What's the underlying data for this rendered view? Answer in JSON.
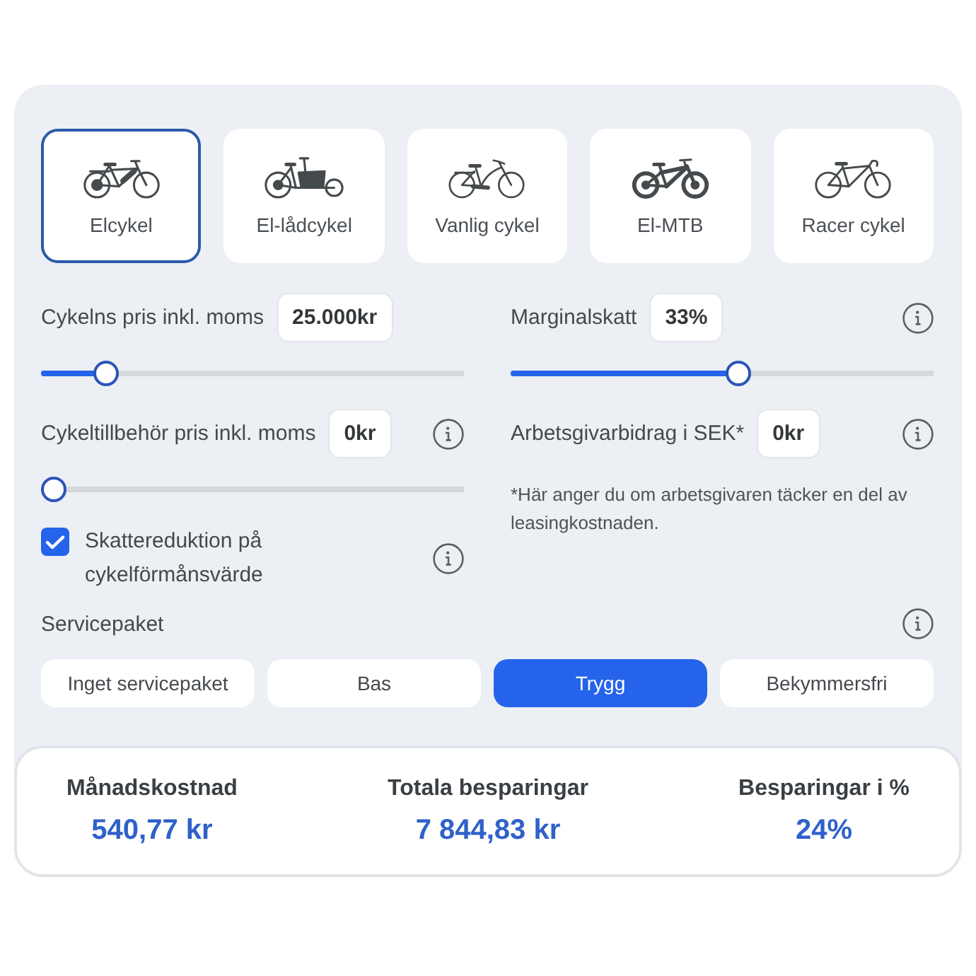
{
  "bike_types": [
    {
      "label": "Elcykel",
      "kind": "ebike",
      "selected": true
    },
    {
      "label": "El-lådcykel",
      "kind": "cargo",
      "selected": false
    },
    {
      "label": "Vanlig cykel",
      "kind": "city",
      "selected": false
    },
    {
      "label": "El-MTB",
      "kind": "mtb",
      "selected": false
    },
    {
      "label": "Racer cykel",
      "kind": "road",
      "selected": false
    }
  ],
  "controls": {
    "left": [
      {
        "kind": "slider",
        "label": "Cykelns pris inkl. moms",
        "value": "25.000kr",
        "level": 0.13
      },
      {
        "kind": "slider",
        "label": "Cykeltillbehör pris inkl. moms",
        "value": "0kr",
        "level": 0,
        "info": true
      },
      {
        "kind": "checkbox",
        "label": "Skattereduktion på cykelförmånsvärde",
        "checked": true,
        "info": true
      }
    ],
    "right": [
      {
        "kind": "slider",
        "label": "Marginalskatt",
        "value": "33%",
        "level": 0.54,
        "info": true
      },
      {
        "kind": "amount",
        "label": "Arbetsgivarbidrag i SEK*",
        "value": "0kr",
        "info": true,
        "note": "*Här anger du om arbetsgivaren täcker en del av leasingkostnaden."
      }
    ]
  },
  "service": {
    "label": "Servicepaket",
    "info": true,
    "options": [
      {
        "label": "Inget servicepaket",
        "selected": false
      },
      {
        "label": "Bas",
        "selected": false
      },
      {
        "label": "Trygg",
        "selected": true
      },
      {
        "label": "Bekymmersfri",
        "selected": false
      }
    ]
  },
  "results": [
    {
      "label": "Månadskostnad",
      "value": "540,77 kr"
    },
    {
      "label": "Totala besparingar",
      "value": "7 844,83 kr"
    },
    {
      "label": "Besparingar i %",
      "value": "24%"
    }
  ]
}
